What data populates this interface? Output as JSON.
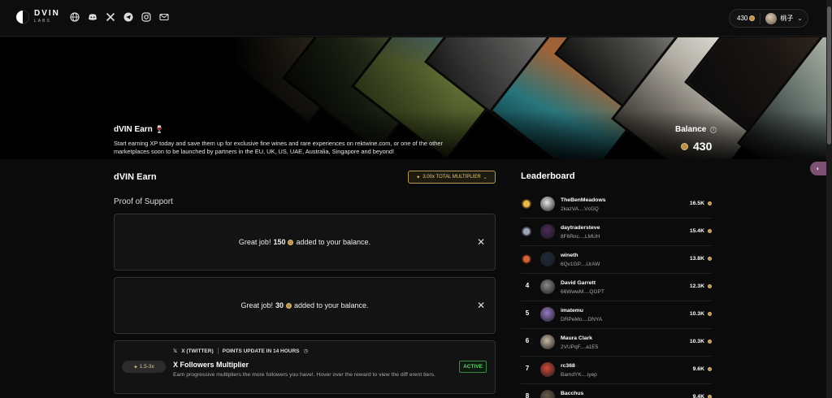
{
  "header": {
    "logo_top": "DVIN",
    "logo_bottom": "LABS",
    "social": [
      "globe-icon",
      "discord-icon",
      "x-icon",
      "telegram-icon",
      "instagram-icon",
      "mail-icon"
    ],
    "points": "430",
    "username": "桃子"
  },
  "hero": {
    "title": "dVIN Earn",
    "description": "Start earning XP today and save them up for exclusive fine wines and rare experiences on rektwine.com, or one of the other marketplaces soon to be launched by partners in the EU, UK, US, UAE, Australia, Singapore and beyond!",
    "balance_label": "Balance",
    "balance_value": "430"
  },
  "earn": {
    "title": "dVIN Earn",
    "multiplier_badge": "3.00x TOTAL MULTIPLIER",
    "proof_title": "Proof of Support",
    "notices": [
      {
        "prefix": "Great job!",
        "amount": "150",
        "suffix": "added to your balance."
      },
      {
        "prefix": "Great job!",
        "amount": "30",
        "suffix": "added to your balance."
      }
    ],
    "task": {
      "multiplier": "1.5-3x",
      "platform": "X (TWITTER)",
      "update_note": "POINTS UPDATE IN 14 HOURS",
      "title": "X Followers Multiplier",
      "description": "Earn progressive multipliers the more followers you have!. Hover over the reward to view the diff erent tiers.",
      "status": "ACTIVE"
    }
  },
  "leaderboard": {
    "title": "Leaderboard",
    "rows": [
      {
        "rank": "1",
        "medal": "gold",
        "name": "TheBenMeadows",
        "address": "2kazVA....VcGQ",
        "score": "16.5K",
        "avatar_color": "#e8e8e8"
      },
      {
        "rank": "2",
        "medal": "silver",
        "name": "daytradersteve",
        "address": "8F6Rnc....LMUH",
        "score": "15.4K",
        "avatar_color": "#4a2a5a"
      },
      {
        "rank": "3",
        "medal": "bronze",
        "name": "wineth",
        "address": "6Qv1GP....UrAW",
        "score": "13.8K",
        "avatar_color": "#1e2a3c"
      },
      {
        "rank": "4",
        "medal": "",
        "name": "David Garrett",
        "address": "66WwwM....QGPT",
        "score": "12.3K",
        "avatar_color": "#8a8a8a"
      },
      {
        "rank": "5",
        "medal": "",
        "name": "imatemu",
        "address": "DRPeMo....DNYA",
        "score": "10.3K",
        "avatar_color": "#9a7ac8"
      },
      {
        "rank": "6",
        "medal": "",
        "name": "Maura Clark",
        "address": "2VUPqF....a1E5",
        "score": "10.3K",
        "avatar_color": "#c9b9a6"
      },
      {
        "rank": "7",
        "medal": "",
        "name": "rc368",
        "address": "BamdYK....iyep",
        "score": "9.6K",
        "avatar_color": "#d24a3a"
      },
      {
        "rank": "8",
        "medal": "",
        "name": "Bacchus",
        "address": "",
        "score": "9.4K",
        "avatar_color": "#6a5a4a"
      }
    ]
  },
  "colors": {
    "accent_gold": "#e4c97e",
    "active_green": "#5cd468",
    "background": "#0b0b0b"
  }
}
